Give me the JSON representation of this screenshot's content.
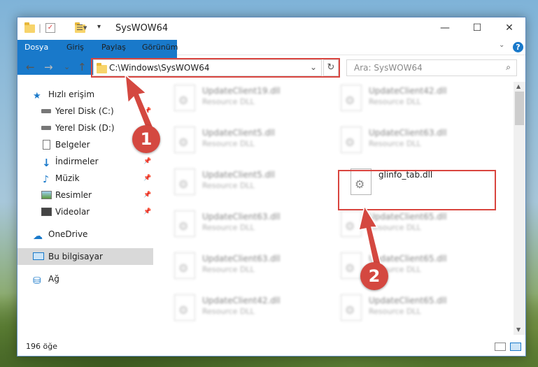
{
  "window": {
    "title": "SysWOW64",
    "minimize": "—",
    "maximize": "☐",
    "close": "✕"
  },
  "ribbon": {
    "tabs": [
      "Dosya",
      "Giriş",
      "Paylaş",
      "Görünüm"
    ],
    "help": "?"
  },
  "nav": {
    "back": "←",
    "forward": "→",
    "recent": "⌄",
    "up": "↑",
    "address": "C:\\Windows\\SysWOW64",
    "address_dropdown": "⌄",
    "refresh": "↻",
    "search_placeholder": "Ara: SysWOW64"
  },
  "sidebar": {
    "items": [
      {
        "label": "Hızlı erişim",
        "icon": "star-icon"
      },
      {
        "label": "Yerel Disk (C:)",
        "icon": "drive-icon",
        "pinned": true
      },
      {
        "label": "Yerel Disk (D:)",
        "icon": "drive-icon"
      },
      {
        "label": "Belgeler",
        "icon": "documents-icon",
        "pinned": true
      },
      {
        "label": "İndirmeler",
        "icon": "download-icon",
        "pinned": true
      },
      {
        "label": "Müzik",
        "icon": "music-icon",
        "pinned": true
      },
      {
        "label": "Resimler",
        "icon": "pictures-icon",
        "pinned": true
      },
      {
        "label": "Videolar",
        "icon": "video-icon",
        "pinned": true
      },
      {
        "label": "OneDrive",
        "icon": "cloud-icon"
      },
      {
        "label": "Bu bilgisayar",
        "icon": "computer-icon",
        "selected": true
      },
      {
        "label": "Ağ",
        "icon": "network-icon"
      }
    ]
  },
  "files": [
    {
      "name": "UpdateClient19.dll",
      "type": "Resource DLL",
      "blurred": true
    },
    {
      "name": "UpdateClient42.dll",
      "type": "Resource DLL",
      "blurred": true
    },
    {
      "name": "UpdateClient5.dll",
      "type": "Resource DLL",
      "blurred": true
    },
    {
      "name": "UpdateClient63.dll",
      "type": "Resource DLL",
      "blurred": true
    },
    {
      "name": "UpdateClient5.dll",
      "type": "Resource DLL",
      "blurred": true
    },
    {
      "name": "glinfo_tab.dll",
      "type": "",
      "blurred": false
    },
    {
      "name": "UpdateClient63.dll",
      "type": "Resource DLL",
      "blurred": true
    },
    {
      "name": "UpdateClient65.dll",
      "type": "Resource DLL",
      "blurred": true
    },
    {
      "name": "UpdateClient63.dll",
      "type": "Resource DLL",
      "blurred": true
    },
    {
      "name": "UpdateClient65.dll",
      "type": "Resource DLL",
      "blurred": true
    },
    {
      "name": "UpdateClient42.dll",
      "type": "Resource DLL",
      "blurred": true
    },
    {
      "name": "UpdateClient65.dll",
      "type": "Resource DLL",
      "blurred": true
    }
  ],
  "status": {
    "item_count": "196 öğe"
  },
  "annotations": {
    "step1": "1",
    "step2": "2",
    "color": "#d9453f"
  },
  "colors": {
    "accent": "#1979ca"
  }
}
